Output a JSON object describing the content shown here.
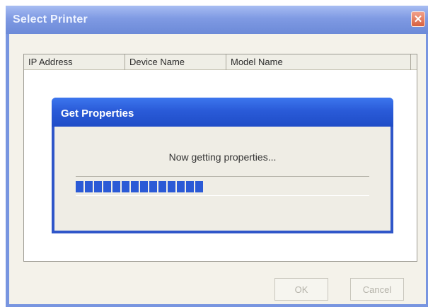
{
  "window": {
    "title": "Select Printer",
    "close_glyph": "✕"
  },
  "list": {
    "columns": [
      "IP Address",
      "Device Name",
      "Model Name"
    ]
  },
  "buttons": {
    "ok_label": "OK",
    "cancel_label": "Cancel"
  },
  "progress_dialog": {
    "title": "Get Properties",
    "message": "Now getting properties...",
    "progress": 0.57,
    "segments_filled": 14
  },
  "colors": {
    "accent": "#2b5ad6",
    "dialog_bg": "#efede5"
  },
  "icons": {
    "close": "close-icon"
  }
}
